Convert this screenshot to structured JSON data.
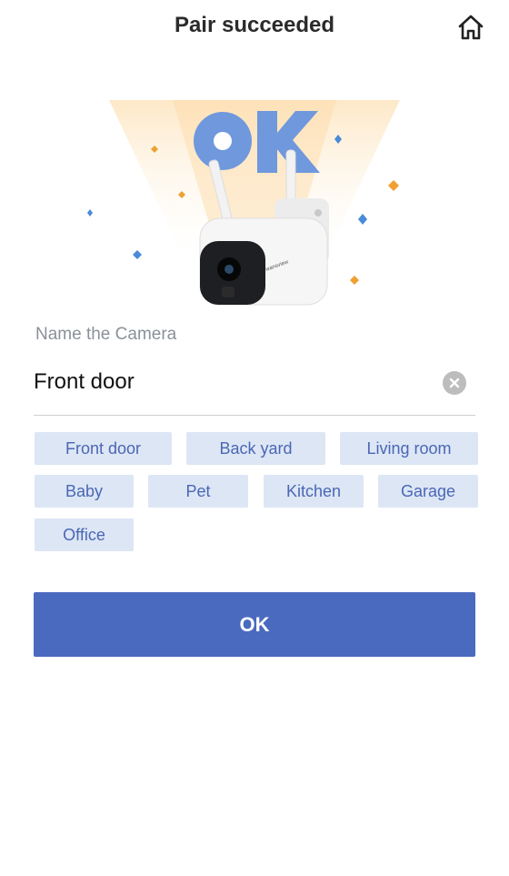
{
  "header": {
    "title": "Pair succeeded",
    "home_icon": "home-icon"
  },
  "hero": {
    "badge_text": "OK",
    "camera_brand": "wansview"
  },
  "name_section": {
    "label": "Name the Camera",
    "value": "Front door",
    "clear_icon": "clear-icon"
  },
  "suggestions": [
    "Front door",
    "Back yard",
    "Living room",
    "Baby",
    "Pet",
    "Kitchen",
    "Garage",
    "Office"
  ],
  "confirm_button": {
    "label": "OK"
  },
  "colors": {
    "accent": "#4a6abf",
    "chip_bg": "#dde6f5",
    "chip_text": "#4a67b5",
    "sparkle_orange": "#f0a030",
    "sparkle_blue": "#4a8ad8"
  }
}
